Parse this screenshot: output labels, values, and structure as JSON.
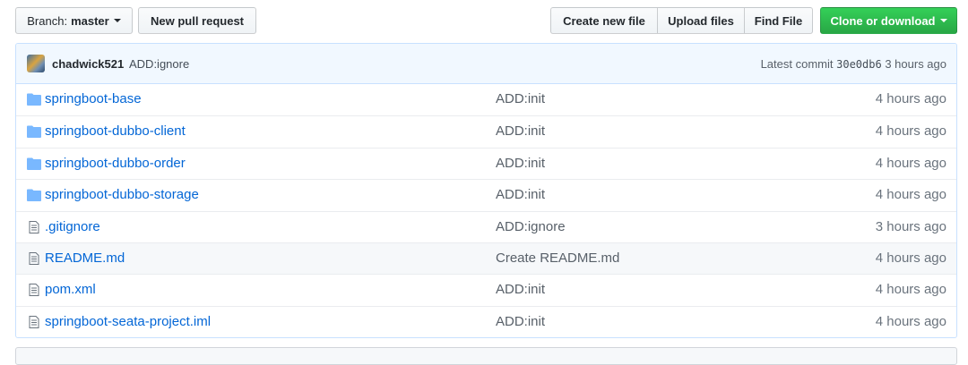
{
  "toolbar": {
    "branch_prefix": "Branch:",
    "branch_name": "master",
    "new_pull_request": "New pull request",
    "create_new_file": "Create new file",
    "upload_files": "Upload files",
    "find_file": "Find File",
    "clone_or_download": "Clone or download"
  },
  "commit": {
    "author": "chadwick521",
    "message": "ADD:ignore",
    "latest_prefix": "Latest commit",
    "sha": "30e0db6",
    "age": "3 hours ago"
  },
  "files": [
    {
      "type": "folder",
      "icon": "folder-icon",
      "name": "springboot-base",
      "message": "ADD:init",
      "age": "4 hours ago"
    },
    {
      "type": "folder",
      "icon": "folder-icon",
      "name": "springboot-dubbo-client",
      "message": "ADD:init",
      "age": "4 hours ago"
    },
    {
      "type": "folder",
      "icon": "folder-icon",
      "name": "springboot-dubbo-order",
      "message": "ADD:init",
      "age": "4 hours ago"
    },
    {
      "type": "folder",
      "icon": "folder-icon",
      "name": "springboot-dubbo-storage",
      "message": "ADD:init",
      "age": "4 hours ago"
    },
    {
      "type": "file",
      "icon": "file-icon",
      "name": ".gitignore",
      "message": "ADD:ignore",
      "age": "3 hours ago"
    },
    {
      "type": "file",
      "icon": "file-icon",
      "name": "README.md",
      "message": "Create README.md",
      "age": "4 hours ago"
    },
    {
      "type": "file",
      "icon": "file-icon",
      "name": "pom.xml",
      "message": "ADD:init",
      "age": "4 hours ago"
    },
    {
      "type": "file",
      "icon": "file-icon",
      "name": "springboot-seata-project.iml",
      "message": "ADD:init",
      "age": "4 hours ago"
    }
  ],
  "colors": {
    "link": "#0366d6",
    "clone_green": "#28a745",
    "commit_bar_bg": "#f1f8ff",
    "folder_icon": "#79b8ff",
    "file_icon": "#6a737d"
  }
}
